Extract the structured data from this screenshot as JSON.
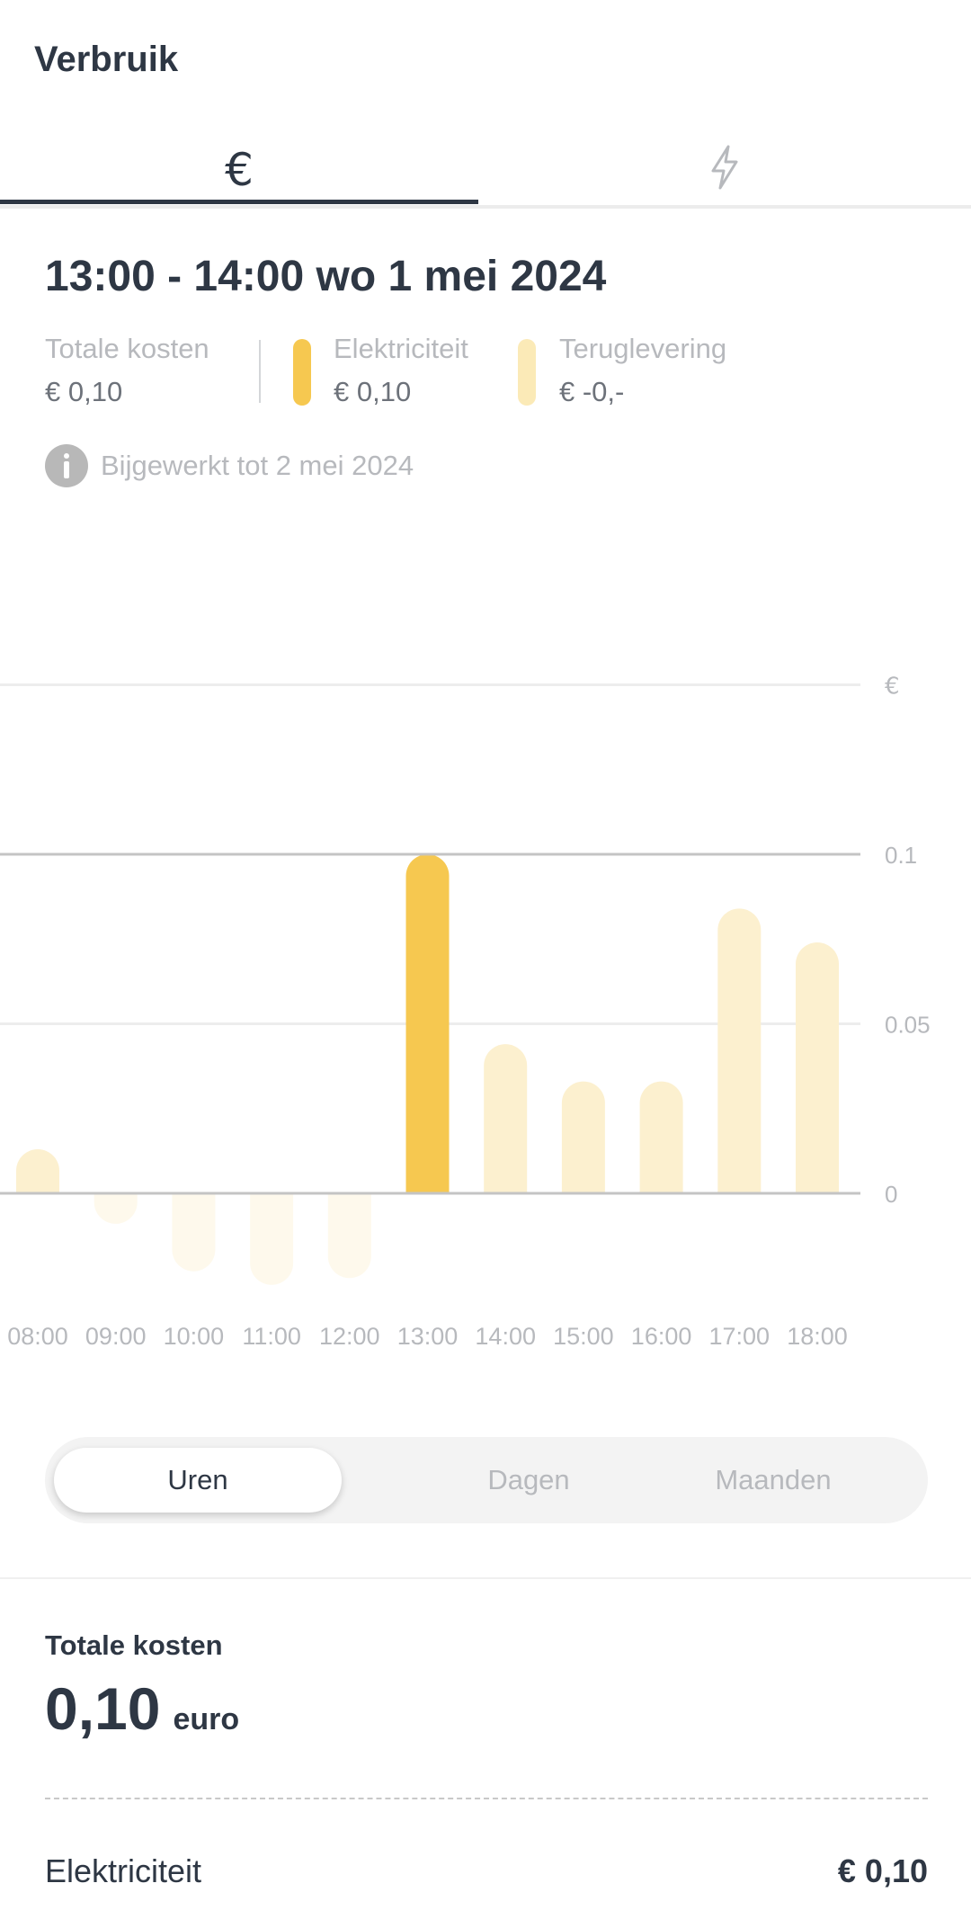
{
  "header": {
    "title": "Verbruik"
  },
  "tabs": [
    {
      "icon": "euro-icon",
      "glyph": "€",
      "active": true
    },
    {
      "icon": "lightning-icon",
      "active": false
    }
  ],
  "selection": {
    "period": "13:00 - 14:00 wo 1 mei 2024",
    "legend": {
      "total": {
        "label": "Totale kosten",
        "value": "€ 0,10"
      },
      "electricity": {
        "label": "Elektriciteit",
        "value": "€ 0,10",
        "color": "#f6c850"
      },
      "feedback": {
        "label": "Teruglevering",
        "value": "€ -0,-",
        "color": "#fbeab7"
      }
    },
    "updated": "Bijgewerkt tot 2 mei 2024"
  },
  "chart_data": {
    "type": "bar",
    "unit_label": "€",
    "categories": [
      "08:00",
      "09:00",
      "10:00",
      "11:00",
      "12:00",
      "13:00",
      "14:00",
      "15:00",
      "16:00",
      "17:00",
      "18:00"
    ],
    "values": [
      0.013,
      -0.009,
      -0.023,
      -0.027,
      -0.025,
      0.1,
      0.044,
      0.033,
      0.033,
      0.084,
      0.074
    ],
    "selected_category": "13:00",
    "yticks": [
      0,
      0.05,
      0.1
    ],
    "ytick_labels": [
      "0",
      "0.05",
      "0.1"
    ],
    "ylim": [
      -0.04,
      0.15
    ],
    "grid": true,
    "colors": {
      "selected": "#f6c850",
      "positive": "#fcf0cf",
      "negative": "#fef9ec"
    }
  },
  "range": {
    "options": [
      "Uren",
      "Dagen",
      "Maanden"
    ],
    "selected": "Uren"
  },
  "summary": {
    "total_label": "Totale kosten",
    "total_value": "0,10",
    "total_unit": "euro",
    "electricity_label": "Elektriciteit",
    "electricity_value": "€ 0,10"
  }
}
